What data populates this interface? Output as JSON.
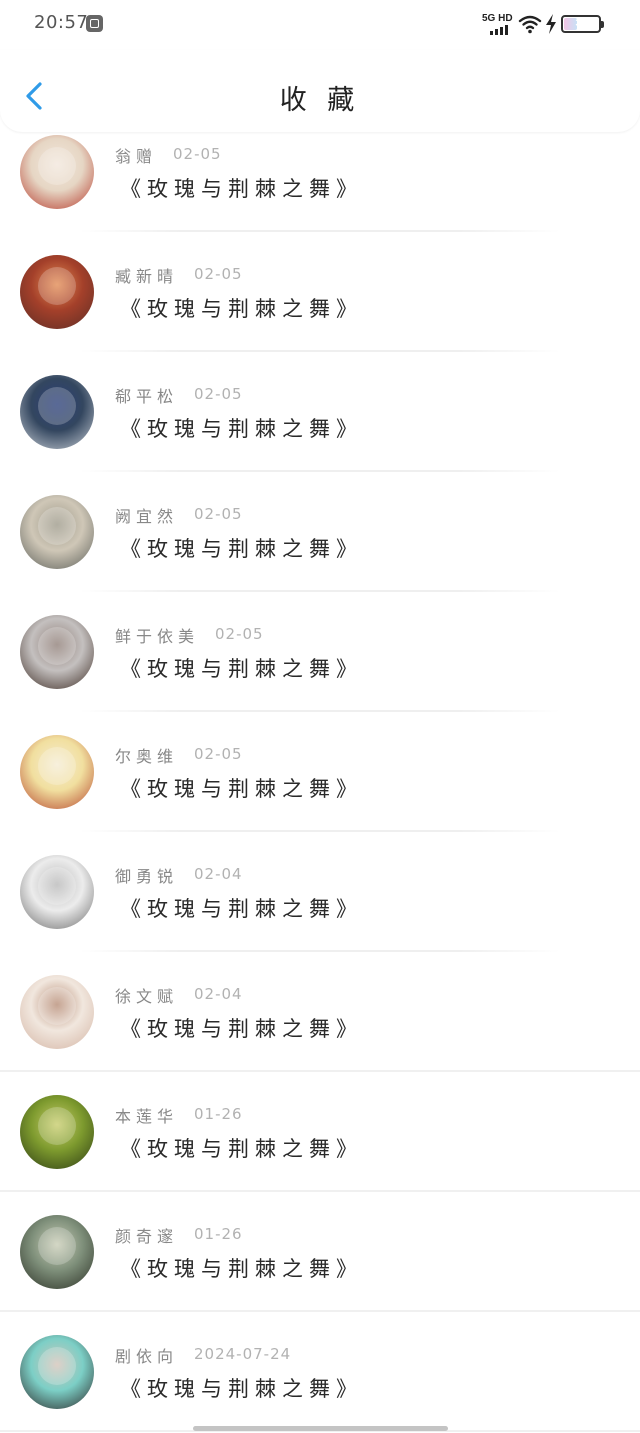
{
  "status_bar": {
    "time": "20:57",
    "app_icon": "app-notification-icon",
    "network_label": "5G HD",
    "battery_level": "37",
    "battery_fraction": 0.37
  },
  "header": {
    "back_icon": "chevron-left-icon",
    "title": "收 藏"
  },
  "favorites": [
    {
      "user": "翁赠",
      "date": "02-05",
      "title": "《玫瑰与荆棘之舞》",
      "avatar_colors": [
        "#e6d6c4",
        "#b5382a",
        "#f2e7dc"
      ]
    },
    {
      "user": "臧新晴",
      "date": "02-05",
      "title": "《玫瑰与荆棘之舞》",
      "avatar_colors": [
        "#a4402a",
        "#5c2d26",
        "#e28a52"
      ]
    },
    {
      "user": "郗平松",
      "date": "02-05",
      "title": "《玫瑰与荆棘之舞》",
      "avatar_colors": [
        "#33465f",
        "#c9cfd6",
        "#2b3f7a"
      ]
    },
    {
      "user": "阙宜然",
      "date": "02-05",
      "title": "《玫瑰与荆棘之舞》",
      "avatar_colors": [
        "#cfc7b7",
        "#5b5e58",
        "#9c9888"
      ]
    },
    {
      "user": "鲜于依美",
      "date": "02-05",
      "title": "《玫瑰与荆棘之舞》",
      "avatar_colors": [
        "#c4c0bf",
        "#3b2a22",
        "#8e7d76"
      ]
    },
    {
      "user": "尔奥维",
      "date": "02-05",
      "title": "《玫瑰与荆棘之舞》",
      "avatar_colors": [
        "#f1df9f",
        "#b5452c",
        "#f5ecd3"
      ]
    },
    {
      "user": "御勇锐",
      "date": "02-04",
      "title": "《玫瑰与荆棘之舞》",
      "avatar_colors": [
        "#ececec",
        "#6a6a6a",
        "#b8b8b8"
      ]
    },
    {
      "user": "徐文赋",
      "date": "02-04",
      "title": "《玫瑰与荆棘之舞》",
      "avatar_colors": [
        "#f1e7de",
        "#d3b3a2",
        "#b68b74"
      ]
    },
    {
      "user": "本莲华",
      "date": "01-26",
      "title": "《玫瑰与荆棘之舞》",
      "avatar_colors": [
        "#7d9a2e",
        "#2c3b14",
        "#c7cc6a"
      ]
    },
    {
      "user": "颜奇邃",
      "date": "01-26",
      "title": "《玫瑰与荆棘之舞》",
      "avatar_colors": [
        "#7e8f7a",
        "#2b3025",
        "#c8ccb5"
      ]
    },
    {
      "user": "剧依向",
      "date": "2024-07-24",
      "title": "《玫瑰与荆棘之舞》",
      "avatar_colors": [
        "#7ccfc6",
        "#2a2424",
        "#d4c3b8"
      ]
    }
  ]
}
